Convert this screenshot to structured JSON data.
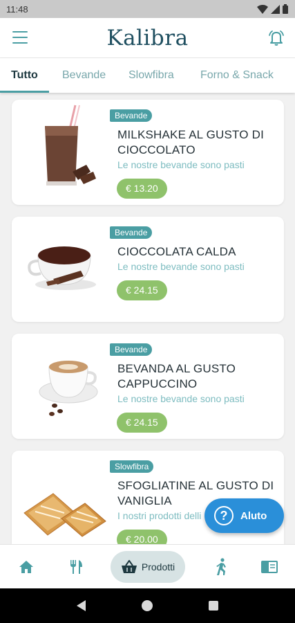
{
  "status_bar": {
    "time": "11:48"
  },
  "header": {
    "brand": "Kalibra"
  },
  "tabs": [
    {
      "label": "Tutto",
      "active": true
    },
    {
      "label": "Bevande",
      "active": false
    },
    {
      "label": "Slowfibra",
      "active": false
    },
    {
      "label": "Forno & Snack",
      "active": false
    }
  ],
  "products": [
    {
      "category": "Bevande",
      "title": "MILKSHAKE AL GUSTO DI CIOCCOLATO",
      "subtitle": "Le nostre bevande sono pasti",
      "price": "€ 13.20"
    },
    {
      "category": "Bevande",
      "title": "CIOCCOLATA CALDA",
      "subtitle": "Le nostre bevande sono pasti",
      "price": "€ 24.15"
    },
    {
      "category": "Bevande",
      "title": "BEVANDA AL GUSTO CAPPUCCINO",
      "subtitle": "Le nostre bevande sono pasti",
      "price": "€ 24.15"
    },
    {
      "category": "Slowfibra",
      "title": "SFOGLIATINE AL GUSTO DI VANIGLIA",
      "subtitle": "I nostri prodotti delli",
      "price": "€ 20.00"
    }
  ],
  "help_button": {
    "label": "Aluto"
  },
  "bottom_nav": {
    "active_label": "Prodotti"
  },
  "colors": {
    "brand": "#1f4f60",
    "accent": "#4a9ea3",
    "price": "#8fc26b",
    "help": "#2a8fd9"
  }
}
